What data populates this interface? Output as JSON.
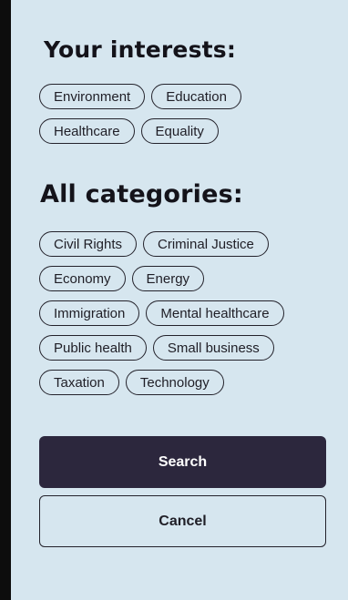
{
  "interests": {
    "title": "Your interests:",
    "rows": [
      [
        "Environment",
        "Education"
      ],
      [
        "Healthcare",
        "Equality"
      ]
    ]
  },
  "categories": {
    "title": "All categories:",
    "rows": [
      [
        "Civil Rights",
        "Criminal Justice"
      ],
      [
        "Economy",
        "Energy"
      ],
      [
        "Immigration",
        "Mental healthcare"
      ],
      [
        "Public health",
        "Small business"
      ],
      [
        "Taxation",
        "Technology"
      ]
    ]
  },
  "actions": {
    "search_label": "Search",
    "cancel_label": "Cancel"
  },
  "colors": {
    "panel_background": "#d6e6ef",
    "primary_button": "#2c273d",
    "outline": "#23222b"
  }
}
